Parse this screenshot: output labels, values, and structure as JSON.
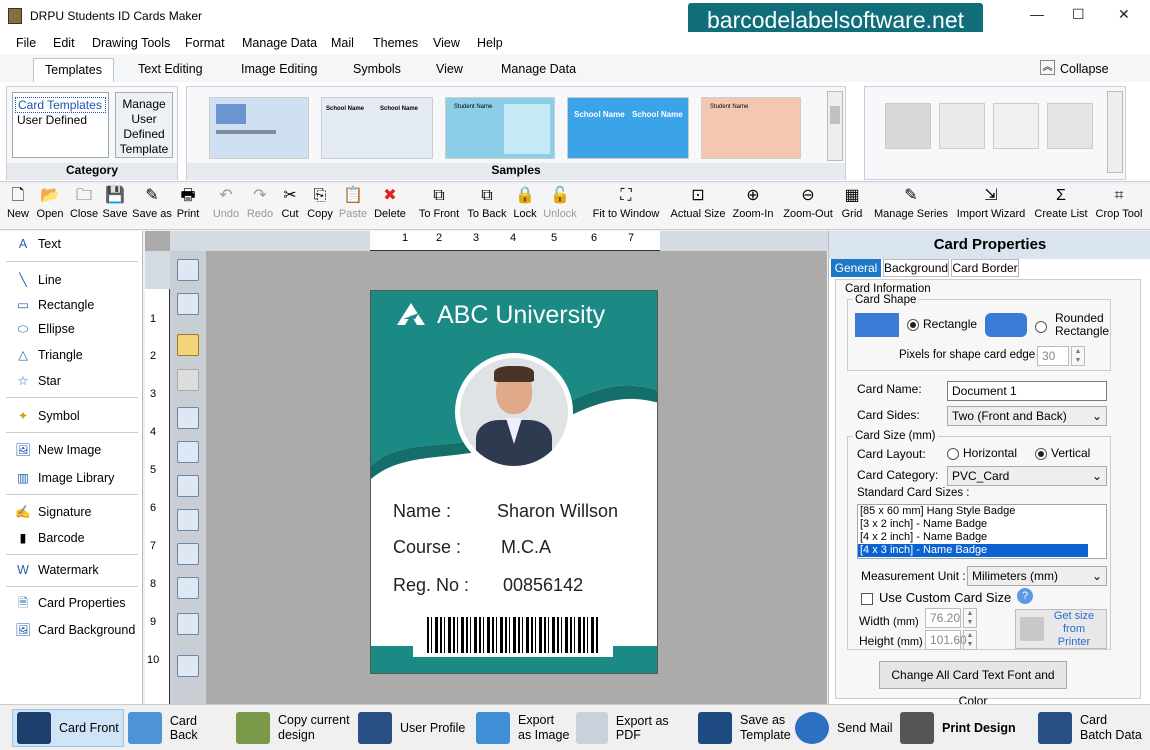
{
  "window": {
    "title": "DRPU Students ID Cards Maker",
    "brand": "barcodelabelsoftware.net",
    "minimize": "—",
    "maximize": "☐",
    "close": "✕"
  },
  "menu": [
    "File",
    "Edit",
    "Drawing Tools",
    "Format",
    "Manage Data",
    "Mail",
    "Themes",
    "View",
    "Help"
  ],
  "ribbon_tabs": [
    "Templates",
    "Text Editing",
    "Image Editing",
    "Symbols",
    "View",
    "Manage Data"
  ],
  "collapse": "Collapse",
  "category": {
    "title": "Category",
    "items": [
      "Card Templates",
      "User Defined"
    ],
    "manage": "Manage User Defined Template"
  },
  "samples": {
    "title": "Samples",
    "t2a": "School Name",
    "t2b": "School Name",
    "t3": "Student Name",
    "t4a": "School Name",
    "t4b": "School Name",
    "t5": "Student Name"
  },
  "toolbar": [
    "New",
    "Open",
    "Close",
    "Save",
    "Save as",
    "Print",
    "Undo",
    "Redo",
    "Cut",
    "Copy",
    "Paste",
    "Delete",
    "To Front",
    "To Back",
    "Lock",
    "Unlock",
    "Fit to Window",
    "Actual Size",
    "Zoom-In",
    "Zoom-Out",
    "Grid",
    "Manage Series",
    "Import Wizard",
    "Create List",
    "Crop Tool"
  ],
  "left_tools": [
    "Text",
    "Line",
    "Rectangle",
    "Ellipse",
    "Triangle",
    "Star",
    "Symbol",
    "New Image",
    "Image Library",
    "Signature",
    "Barcode",
    "Watermark",
    "Card Properties",
    "Card Background"
  ],
  "ruler_h": [
    "1",
    "2",
    "3",
    "4",
    "5",
    "6",
    "7"
  ],
  "ruler_v": [
    "1",
    "2",
    "3",
    "4",
    "5",
    "6",
    "7",
    "8",
    "9",
    "10"
  ],
  "card": {
    "university": "ABC University",
    "name_label": "Name :",
    "name": "Sharon Willson",
    "course_label": "Course :",
    "course": "M.C.A",
    "reg_label": "Reg. No :",
    "reg": "00856142",
    "accent": "#1b8a85"
  },
  "props": {
    "title": "Card Properties",
    "tabs": [
      "General",
      "Background",
      "Card Border"
    ],
    "card_information": "Card Information",
    "card_shape": "Card Shape",
    "rectangle": "Rectangle",
    "rounded": "Rounded Rectangle",
    "pixels_label": "Pixels for shape card edge :",
    "pixels_value": "30",
    "card_name_label": "Card Name:",
    "card_name": "Document 1",
    "card_sides_label": "Card Sides:",
    "card_sides": "Two (Front and Back)",
    "card_size": "Card Size (mm)",
    "layout_label": "Card Layout:",
    "horizontal": "Horizontal",
    "vertical": "Vertical",
    "category_label": "Card Category:",
    "category": "PVC_Card",
    "std_label": "Standard Card Sizes :",
    "std_sizes": [
      "[85 x 60 mm] Hang Style Badge",
      "[3 x 2 inch] - Name Badge",
      "[4 x 2 inch] - Name Badge",
      "[4 x 3 inch] - Name Badge"
    ],
    "unit_label": "Measurement Unit :",
    "unit": "Milimeters (mm)",
    "custom": "Use Custom Card Size",
    "width_label": "Width",
    "height_label": "Height",
    "mm": "(mm)",
    "width": "76.20",
    "height": "101.60",
    "get_size": "Get size from Printer",
    "change_all": "Change All Card Text Font and Color"
  },
  "bottom": [
    "Card Front",
    "Card Back",
    "Copy current design",
    "User Profile",
    "Export as Image",
    "Export as PDF",
    "Save as Template",
    "Send Mail",
    "Print Design",
    "Card Batch Data"
  ]
}
